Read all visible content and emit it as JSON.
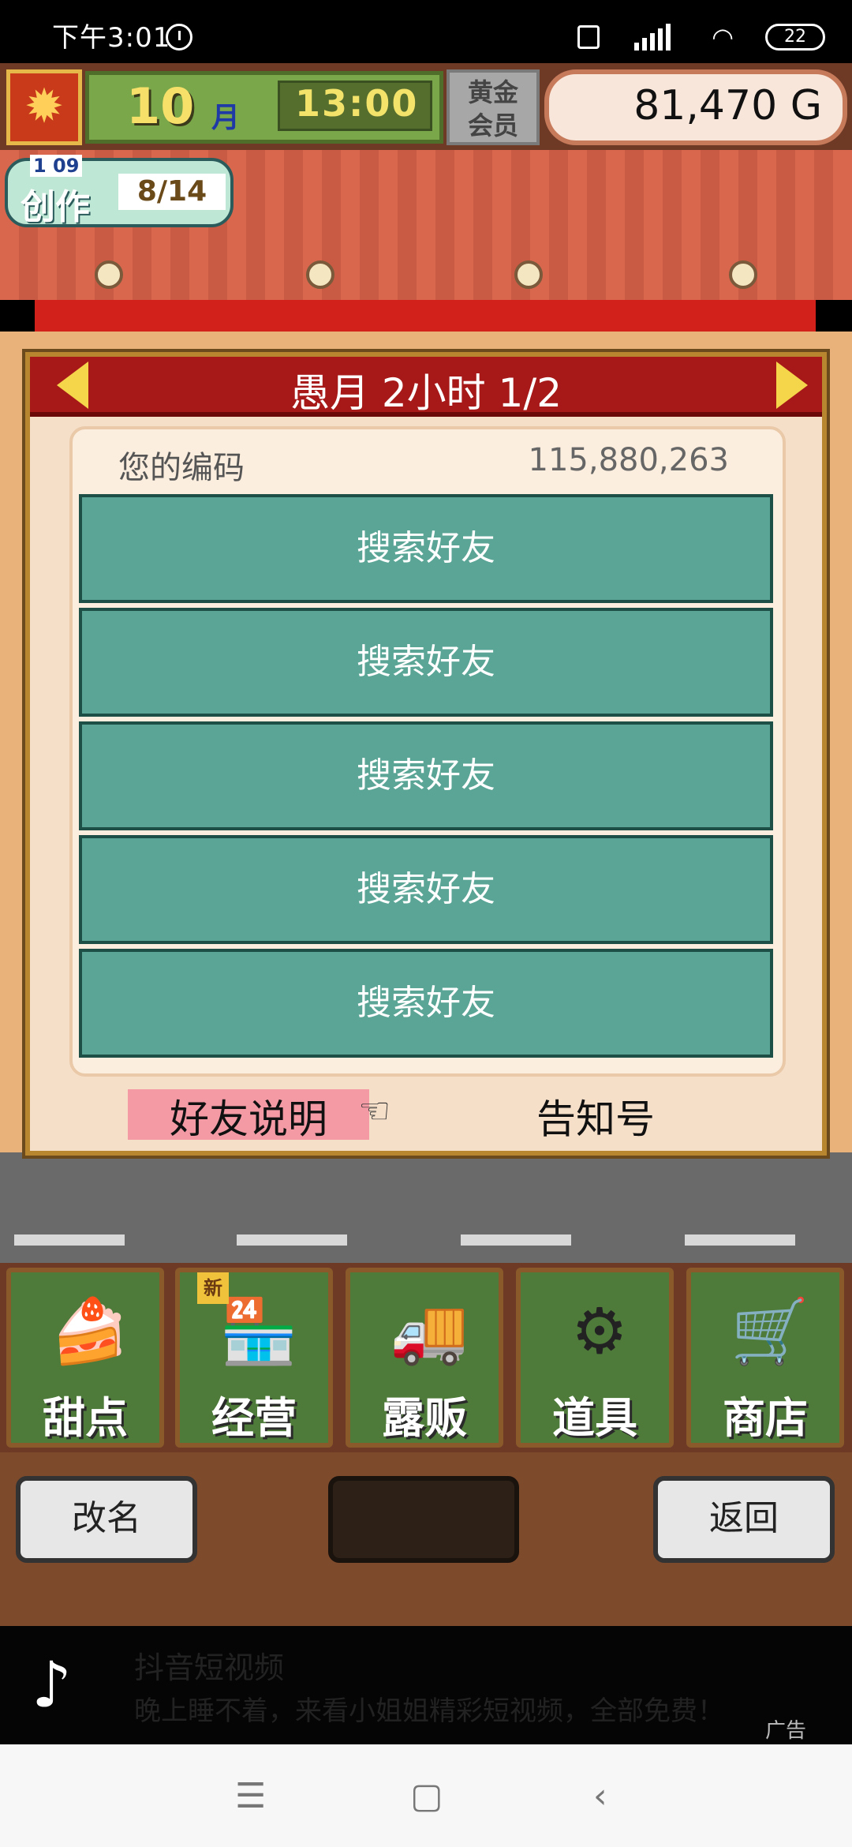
{
  "status_bar": {
    "time": "下午3:01",
    "battery": "22"
  },
  "hud": {
    "month_number": "10",
    "month_unit": "月",
    "clock": "13:00",
    "gold_member": "黄金\n会员",
    "money": "81,470 G",
    "create_label": "创作",
    "create_progress": "8/14",
    "create_level": "1 09"
  },
  "panel": {
    "title": "愚月 2小时 1/2",
    "code_label": "您的编码",
    "code_value": "115,880,263",
    "friend_buttons": [
      "搜索好友",
      "搜索好友",
      "搜索好友",
      "搜索好友",
      "搜索好友"
    ],
    "explain": "好友说明",
    "notice": "告知号"
  },
  "menu": {
    "items": [
      {
        "label": "甜点",
        "icon": "cake-icon"
      },
      {
        "label": "经营",
        "icon": "shop-icon"
      },
      {
        "label": "露贩",
        "icon": "truck-icon"
      },
      {
        "label": "道具",
        "icon": "items-icon"
      },
      {
        "label": "商店",
        "icon": "cart-icon"
      }
    ],
    "new_badge": "新"
  },
  "lower": {
    "rename": "改名",
    "back": "返回"
  },
  "ad": {
    "name": "抖音短视频",
    "desc": "晚上睡不着，来看小姐姐精彩短视频，全部免费！",
    "tag": "广告"
  }
}
